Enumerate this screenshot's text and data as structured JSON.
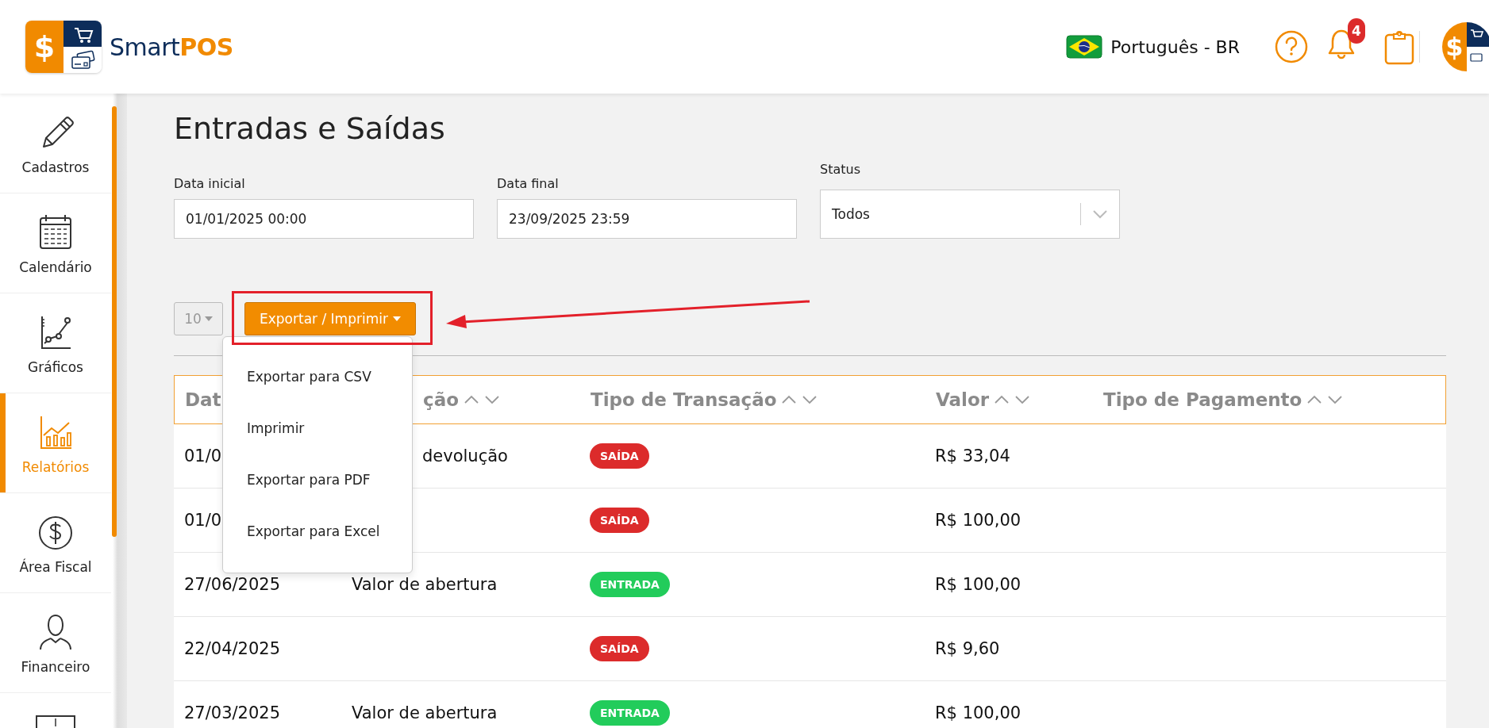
{
  "header": {
    "brand": {
      "symbol": "$",
      "name": "Smart",
      "accent": "POS"
    },
    "language": "Português - BR",
    "notifications": "4",
    "avatar_symbol": "$"
  },
  "sidebar": {
    "items": [
      {
        "label": "Cadastros",
        "selected": false
      },
      {
        "label": "Calendário",
        "selected": false
      },
      {
        "label": "Gráficos",
        "selected": false
      },
      {
        "label": "Relatórios",
        "selected": true
      },
      {
        "label": "Área Fiscal",
        "selected": false
      },
      {
        "label": "Financeiro",
        "selected": false
      }
    ]
  },
  "page_title": "Entradas e Saídas",
  "filters": [
    {
      "kind": "text",
      "label": "Data inicial",
      "value": "01/01/2025 00:00"
    },
    {
      "kind": "text",
      "label": "Data final",
      "value": "23/09/2025 23:59"
    },
    {
      "kind": "select",
      "label": "Status",
      "value": "Todos"
    }
  ],
  "toolbar": {
    "page_size": "10",
    "export_button": "Exportar / Imprimir",
    "export_menu": {
      "open": true,
      "items": [
        "Exportar para CSV",
        "Imprimir",
        "Exportar para PDF",
        "Exportar para Excel"
      ]
    }
  },
  "table": {
    "columns": [
      {
        "label": "Dat",
        "sort": false
      },
      {
        "label": "ção",
        "sort": true
      },
      {
        "label": "Tipo de Transação",
        "sort": true
      },
      {
        "label": "Valor",
        "sort": true
      },
      {
        "label": "Tipo de Pagamento",
        "sort": true
      }
    ],
    "rows": [
      {
        "date": "01/0",
        "description": "devolução",
        "type": {
          "text": "SAÍDA",
          "color": "#dc2b2b"
        },
        "value": "R$ 33,04"
      },
      {
        "date": "01/0",
        "description": "",
        "type": {
          "text": "SAÍDA",
          "color": "#dc2b2b"
        },
        "value": "R$ 100,00"
      },
      {
        "date": "27/06/2025",
        "description": "Valor de abertura",
        "type": {
          "text": "ENTRADA",
          "color": "#22cc5b"
        },
        "value": "R$ 100,00"
      },
      {
        "date": "22/04/2025",
        "description": "",
        "type": {
          "text": "SAÍDA",
          "color": "#dc2b2b"
        },
        "value": "R$ 9,60"
      },
      {
        "date": "27/03/2025",
        "description": "Valor de abertura",
        "type": {
          "text": "ENTRADA",
          "color": "#22cc5b"
        },
        "value": "R$ 100,00"
      }
    ]
  }
}
